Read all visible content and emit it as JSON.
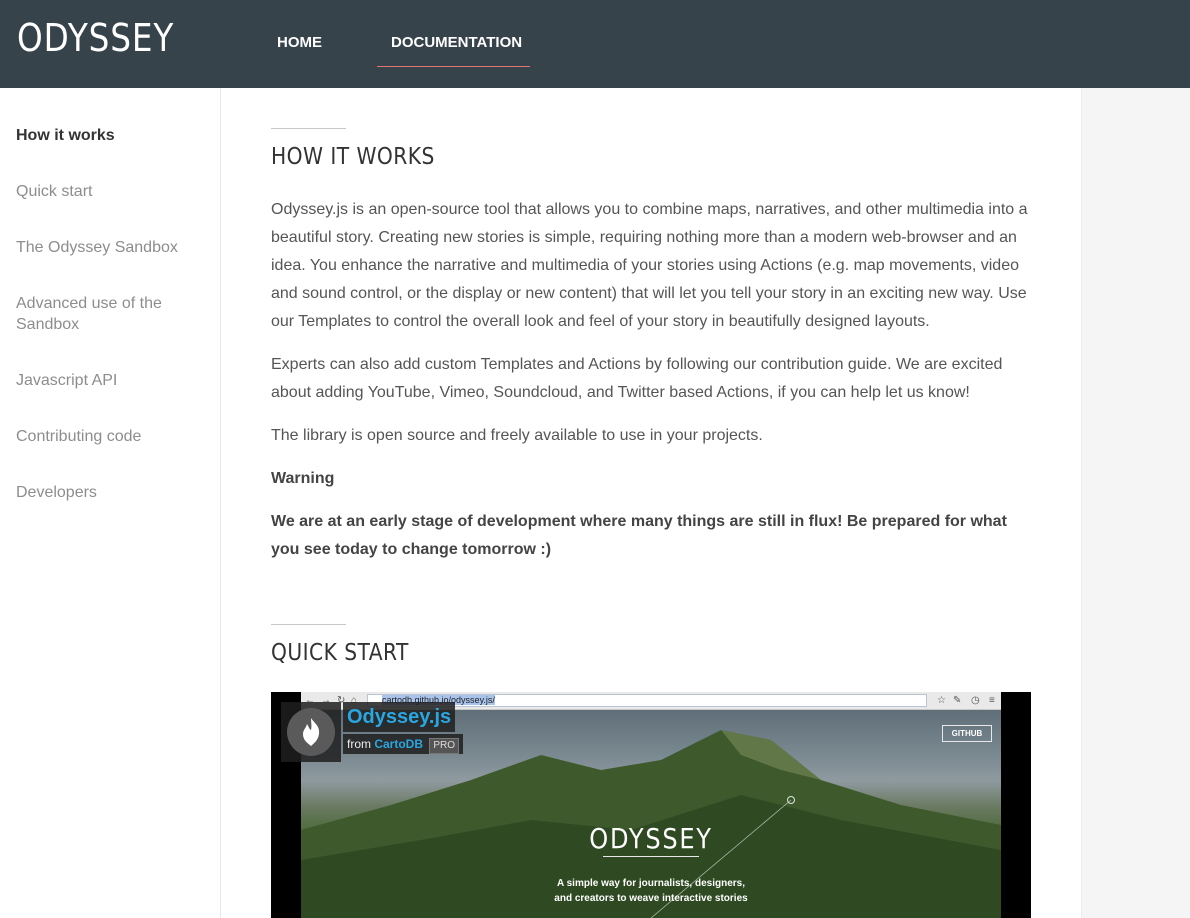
{
  "header": {
    "logo": "ODYSSEY",
    "nav": [
      {
        "label": "HOME"
      },
      {
        "label": "DOCUMENTATION",
        "active": true
      }
    ],
    "accent_color": "#e57373"
  },
  "sidebar": {
    "items": [
      {
        "label": "How it works",
        "active": true
      },
      {
        "label": "Quick start"
      },
      {
        "label": "The Odyssey Sandbox"
      },
      {
        "label": "Advanced use of the Sandbox"
      },
      {
        "label": "Javascript API"
      },
      {
        "label": "Contributing code"
      },
      {
        "label": "Developers"
      }
    ]
  },
  "sections": {
    "how_it_works": {
      "title": "HOW IT WORKS",
      "p1": "Odyssey.js is an open-source tool that allows you to combine maps, narratives, and other multimedia into a beautiful story. Creating new stories is simple, requiring nothing more than a modern web-browser and an idea. You enhance the narrative and multimedia of your stories using Actions (e.g. map movements, video and sound control, or the display or new content) that will let you tell your story in an exciting new way. Use our Templates to control the overall look and feel of your story in beautifully designed layouts.",
      "p2": "Experts can also add custom Templates and Actions by following our contribution guide. We are excited about adding YouTube, Vimeo, Soundcloud, and Twitter based Actions, if you can help let us know!",
      "p3": "The library is open source and freely available to use in your projects.",
      "warning_label": "Warning",
      "warning_text": "We are at an early stage of development where many things are still in flux! Be prepared for what you see today to change tomorrow :)"
    },
    "quick_start": {
      "title": "QUICK START"
    }
  },
  "video": {
    "url_host": "cartodb.github.io",
    "url_path": "/odyssey.js/",
    "channel_title": "Odyssey.js",
    "from_label": "from",
    "channel_name": "CartoDB",
    "channel_badge": "PRO",
    "github_button": "GITHUB",
    "scene_title": "ODYSSEY",
    "tagline_line1": "A simple way for journalists, designers,",
    "tagline_line2": "and creators to weave interactive stories"
  }
}
